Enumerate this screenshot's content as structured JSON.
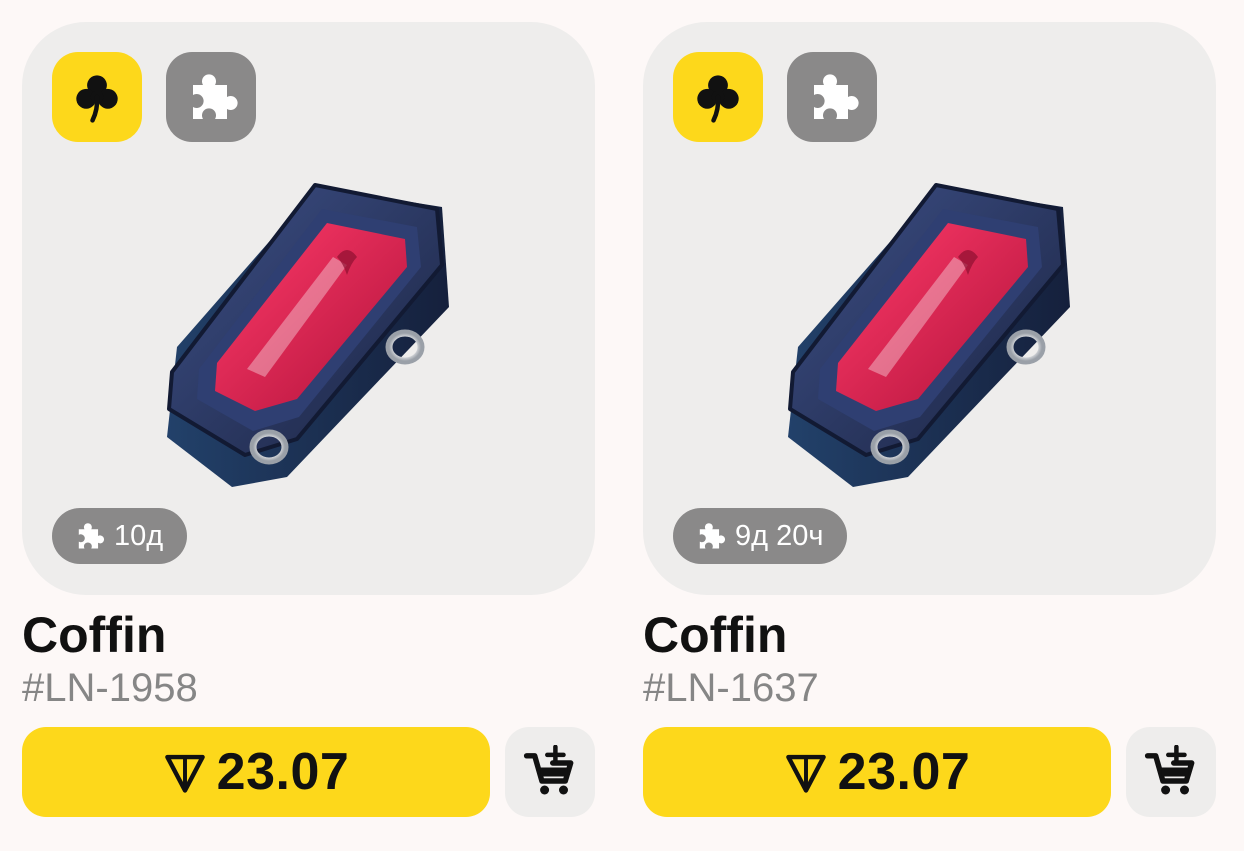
{
  "colors": {
    "background": "#fdf8f7",
    "card_bg": "#eeedec",
    "accent_yellow": "#fdd81b",
    "chip_gray": "#8a8989",
    "text_dark": "#111111",
    "text_muted": "#868686"
  },
  "icons": {
    "clover": "clover-icon",
    "puzzle": "puzzle-icon",
    "ton": "ton-diamond-icon",
    "cart": "add-to-cart-icon"
  },
  "items": [
    {
      "name": "Coffin",
      "serial": "#LN-1958",
      "timer": "10д",
      "price": "23.07"
    },
    {
      "name": "Coffin",
      "serial": "#LN-1637",
      "timer": "9д 20ч",
      "price": "23.07"
    }
  ]
}
